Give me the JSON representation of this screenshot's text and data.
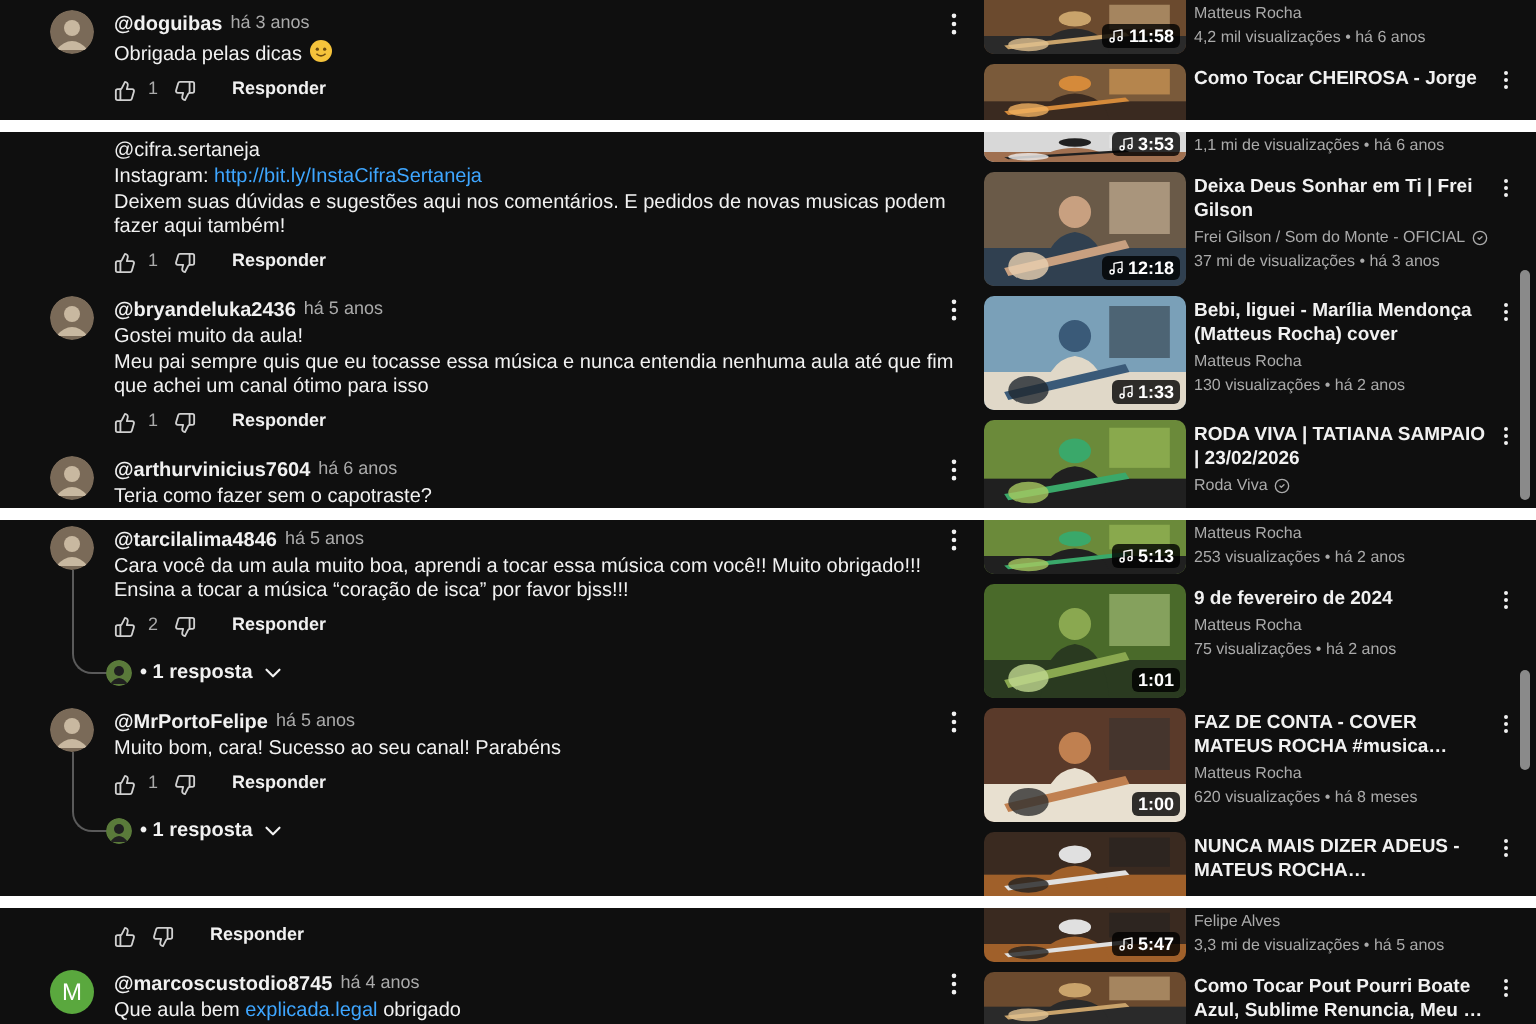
{
  "strips": [
    {
      "comments": [
        {
          "author": "@doguibas",
          "time": "há 3 anos",
          "avatar": {
            "kind": "picture"
          },
          "lines": [
            {
              "text": "Obrigada pelas dicas",
              "emoji": true
            }
          ],
          "likes": "1",
          "reply_label": "Responder"
        }
      ],
      "videos": [
        {
          "channel": "Matteus Rocha",
          "verified": false,
          "stats": "4,2 mil visualizações • há 6 anos",
          "duration": "11:58",
          "music": true
        },
        {
          "title": "Como Tocar CHEIROSA - Jorge"
        }
      ]
    },
    {
      "comments": [
        {
          "lines": [
            {
              "text": "@cifra.sertaneja"
            },
            {
              "text": "Instagram:",
              "link": "http://bit.ly/InstaCifraSertaneja"
            },
            {
              "text": "Deixem suas dúvidas e sugestões aqui nos comentários. E pedidos de novas musicas podem fazer aqui também!"
            }
          ],
          "likes": "1",
          "reply_label": "Responder"
        },
        {
          "author": "@bryandeluka2436",
          "time": "há 5 anos",
          "avatar": {
            "kind": "picture"
          },
          "lines": [
            {
              "text": "Gostei muito da aula!"
            },
            {
              "text": "Meu pai sempre quis que eu tocasse essa música e nunca entendia nenhuma aula até que fim que achei um canal ótimo para isso"
            }
          ],
          "likes": "1",
          "reply_label": "Responder"
        },
        {
          "author": "@arthurvinicius7604",
          "time": "há 6 anos",
          "avatar": {
            "kind": "picture"
          },
          "lines": [
            {
              "text": "Teria como fazer sem o capotraste?"
            }
          ]
        }
      ],
      "videos": [
        {
          "stats": "1,1 mi de visualizações • há 6 anos",
          "duration": "3:53",
          "music": true
        },
        {
          "title": "Deixa Deus Sonhar em Ti | Frei Gilson",
          "channel": "Frei Gilson / Som do Monte - OFICIAL",
          "verified": true,
          "stats": "37 mi de visualizações • há 3 anos",
          "duration": "12:18",
          "music": true
        },
        {
          "title": "Bebi, liguei -  Marília  Mendonça (Matteus Rocha) cover",
          "channel": "Matteus Rocha",
          "verified": false,
          "stats": "130 visualizações • há 2 anos",
          "duration": "1:33",
          "music": true
        },
        {
          "title": "RODA VIVA | TATIANA SAMPAIO | 23/02/2026",
          "channel": "Roda Viva",
          "verified": true
        }
      ]
    },
    {
      "comments": [
        {
          "author": "@tarcilalima4846",
          "time": "há 5 anos",
          "avatar": {
            "kind": "picture"
          },
          "lines": [
            {
              "text": "Cara você da um aula muito boa, aprendi a tocar essa música com você!! Muito obrigado!!! Ensina a tocar a música “coração de isca” por favor bjss!!!"
            }
          ],
          "likes": "2",
          "reply_label": "Responder",
          "replies": "• 1 resposta"
        },
        {
          "author": "@MrPortoFelipe",
          "time": "há 5 anos",
          "avatar": {
            "kind": "picture"
          },
          "lines": [
            {
              "text": "Muito bom, cara! Sucesso ao seu canal! Parabéns"
            }
          ],
          "likes": "1",
          "reply_label": "Responder",
          "replies": "• 1 resposta"
        }
      ],
      "videos": [
        {
          "channel": "Matteus Rocha",
          "verified": false,
          "stats": "253 visualizações • há 2 anos",
          "duration": "5:13",
          "music": true
        },
        {
          "title": "9 de fevereiro de 2024",
          "channel": "Matteus Rocha",
          "verified": false,
          "stats": "75 visualizações • há 2 anos",
          "duration": "1:01",
          "music": false
        },
        {
          "title": "FAZ DE CONTA - COVER MATEUS ROCHA #musica…",
          "channel": "Matteus Rocha",
          "verified": false,
          "stats": "620 visualizações • há 8 meses",
          "duration": "1:00",
          "music": false
        },
        {
          "title": "NUNCA MAIS DIZER ADEUS - MATEUS ROCHA…"
        }
      ]
    },
    {
      "comments": [
        {
          "reply_label": "Responder"
        },
        {
          "author": "@marcoscustodio8745",
          "time": "há 4 anos",
          "avatar": {
            "kind": "letter",
            "letter": "M",
            "color": "#5aa83e"
          },
          "lines": [
            {
              "text": "Que aula bem",
              "link": "explicada.legal",
              "after": "obrigado"
            }
          ]
        }
      ],
      "videos": [
        {
          "channel": "Felipe Alves",
          "verified": false,
          "stats": "3,3 mi de visualizações • há 5 anos",
          "duration": "5:47",
          "music": true
        },
        {
          "title": "Como Tocar Pout Pourri Boate Azul, Sublime Renuncia, Meu …"
        }
      ]
    }
  ]
}
